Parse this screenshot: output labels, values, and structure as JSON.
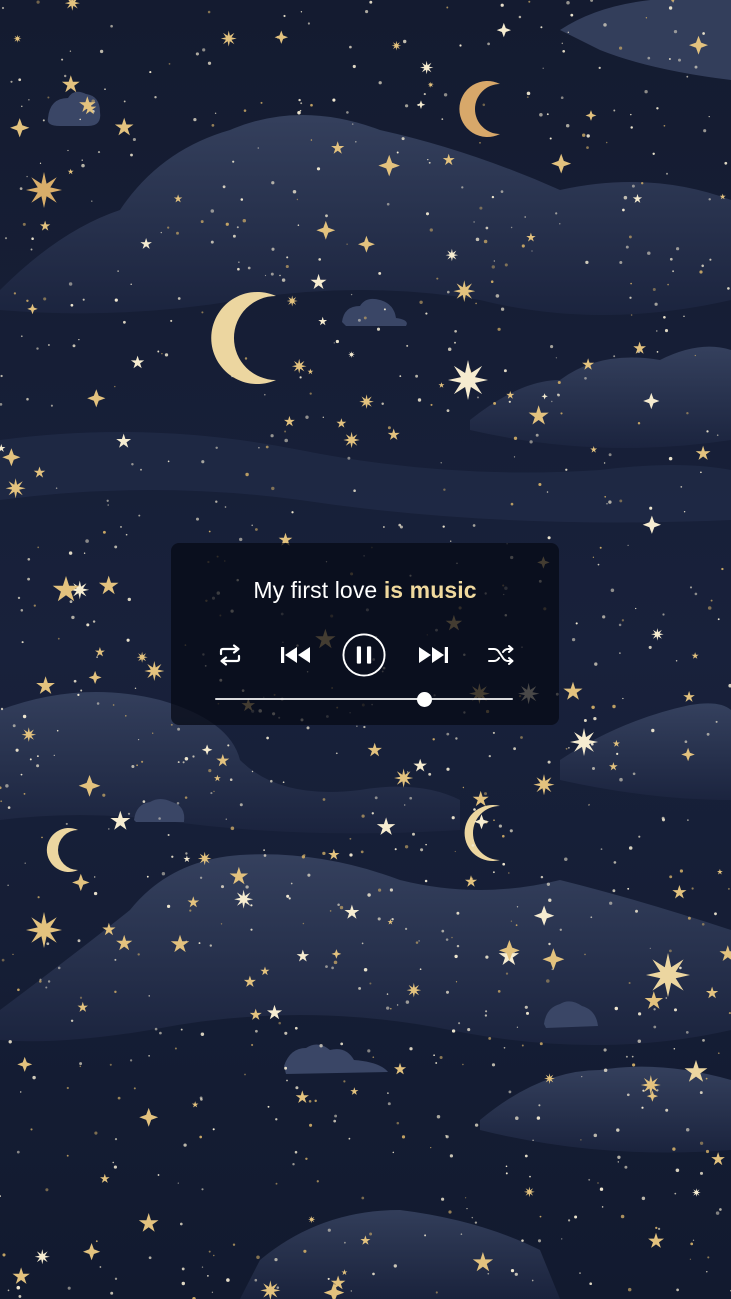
{
  "player": {
    "title_main": "My first love ",
    "title_highlight": "is music",
    "progress": 0.7,
    "controls": {
      "repeat_icon": "repeat-icon",
      "previous_icon": "previous-icon",
      "pause_icon": "pause-icon",
      "next_icon": "next-icon",
      "shuffle_icon": "shuffle-icon"
    }
  },
  "colors": {
    "sky": "#141c33",
    "cloud": "#2a3654",
    "star_gold": "#e3c27e",
    "highlight_text": "#f0d99e"
  }
}
